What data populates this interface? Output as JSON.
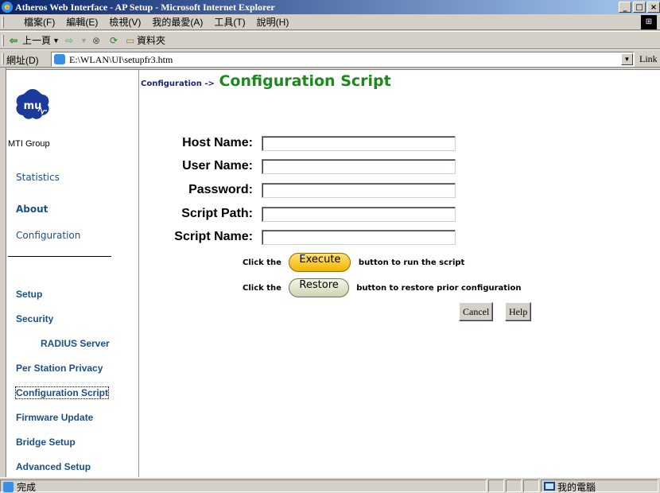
{
  "window": {
    "title": "Atheros Web Interface - AP Setup - Microsoft Internet Explorer",
    "buttons": {
      "minimize": "_",
      "maximize": "□",
      "close": "×"
    }
  },
  "menubar": {
    "items": [
      "檔案(F)",
      "編輯(E)",
      "檢視(V)",
      "我的最愛(A)",
      "工具(T)",
      "說明(H)"
    ]
  },
  "toolbar": {
    "back_label": "上一頁",
    "folders_label": "資料夾"
  },
  "addressbar": {
    "label": "網址(D)",
    "url": "E:\\WLAN\\UI\\setupfr3.htm",
    "links_label": "Link"
  },
  "sidebar": {
    "org_name": "MTI Group",
    "top_links": [
      "Statistics",
      "About",
      "Configuration"
    ],
    "menu": [
      {
        "label": "Setup"
      },
      {
        "label": "Security"
      },
      {
        "label": "RADIUS Server"
      },
      {
        "label": "Per Station Privacy"
      },
      {
        "label": "Configuration Script"
      },
      {
        "label": "Firmware Update"
      },
      {
        "label": "Bridge Setup"
      },
      {
        "label": "Advanced Setup"
      }
    ]
  },
  "main": {
    "breadcrumb": "Configuration ->",
    "title": "Configuration Script",
    "form": {
      "host_name_label": "Host Name:",
      "user_name_label": "User Name:",
      "password_label": "Password:",
      "script_path_label": "Script Path:",
      "script_name_label": "Script Name:",
      "host_name_value": "",
      "user_name_value": "",
      "password_value": "",
      "script_path_value": "",
      "script_name_value": ""
    },
    "execute_row": {
      "prefix": "Click the",
      "button": "Execute",
      "suffix": "button to run the script"
    },
    "restore_row": {
      "prefix": "Click the",
      "button": "Restore",
      "suffix": "button to restore prior configuration"
    },
    "cancel_label": "Cancel",
    "help_label": "Help"
  },
  "statusbar": {
    "status_text": "完成",
    "zone_text": "我的電腦"
  },
  "colors": {
    "title_text": "#1a8a1a",
    "nav_link": "#1a4f8a",
    "execute_button": "#f3b400"
  }
}
